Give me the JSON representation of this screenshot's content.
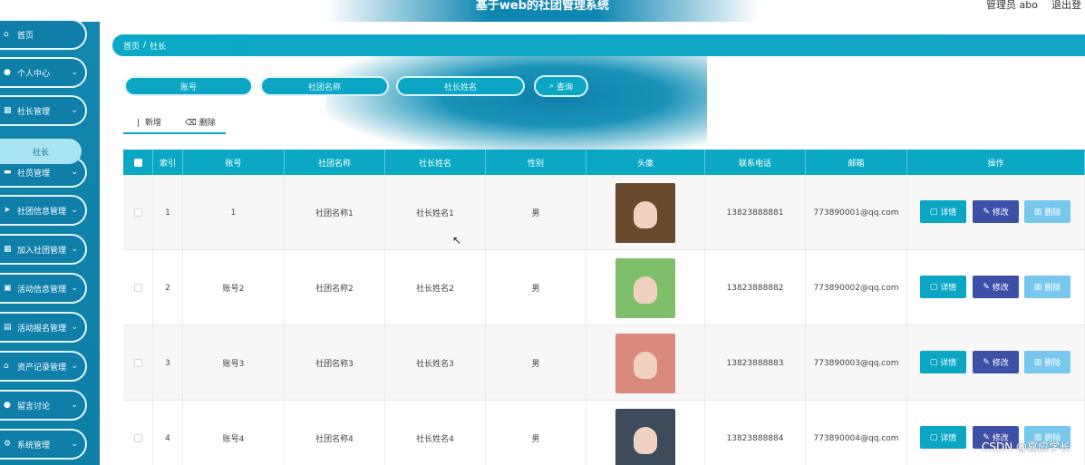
{
  "header": {
    "title": "基于web的社团管理系统",
    "admin_label": "管理员 abo",
    "logout_label": "退出登"
  },
  "sidebar": {
    "items": [
      {
        "label": "首页",
        "icon": "home-icon",
        "glyph": "⌂",
        "has_chevron": false
      },
      {
        "label": "个人中心",
        "icon": "user-icon",
        "glyph": "●",
        "has_chevron": true
      },
      {
        "label": "社长管理",
        "icon": "building-icon",
        "glyph": "▦",
        "has_chevron": true
      },
      {
        "label": "社员管理",
        "icon": "card-icon",
        "glyph": "▬",
        "has_chevron": true
      },
      {
        "label": "社团信息管理",
        "icon": "send-icon",
        "glyph": "➤",
        "has_chevron": true
      },
      {
        "label": "加入社团管理",
        "icon": "building-icon",
        "glyph": "▦",
        "has_chevron": true
      },
      {
        "label": "活动信息管理",
        "icon": "calendar-icon",
        "glyph": "▣",
        "has_chevron": true
      },
      {
        "label": "活动报名管理",
        "icon": "list-icon",
        "glyph": "▤",
        "has_chevron": true
      },
      {
        "label": "资产记录管理",
        "icon": "home-icon",
        "glyph": "⌂",
        "has_chevron": true
      },
      {
        "label": "留言讨论",
        "icon": "pin-icon",
        "glyph": "●",
        "has_chevron": true
      },
      {
        "label": "系统管理",
        "icon": "gear-icon",
        "glyph": "⚙",
        "has_chevron": true
      }
    ],
    "sub_item": "社长"
  },
  "breadcrumb": {
    "home": "首页",
    "separator": "/",
    "current": "社长"
  },
  "search": {
    "account_placeholder": "账号",
    "club_placeholder": "社团名称",
    "leader_placeholder": "社长姓名",
    "query_label": "查询"
  },
  "toolbar": {
    "add_label": "新增",
    "delete_label": "删除"
  },
  "table": {
    "headers": [
      "索引",
      "账号",
      "社团名称",
      "社长姓名",
      "性别",
      "头像",
      "联系电话",
      "邮箱",
      "操作"
    ],
    "rows": [
      {
        "index": "1",
        "account": "1",
        "club": "社团名称1",
        "leader": "社长姓名1",
        "gender": "男",
        "phone": "13823888881",
        "email": "773890001@qq.com",
        "avatar_bg": "#6a4a2c"
      },
      {
        "index": "2",
        "account": "账号2",
        "club": "社团名称2",
        "leader": "社长姓名2",
        "gender": "男",
        "phone": "13823888882",
        "email": "773890002@qq.com",
        "avatar_bg": "#7fbf6a"
      },
      {
        "index": "3",
        "account": "账号3",
        "club": "社团名称3",
        "leader": "社长姓名3",
        "gender": "男",
        "phone": "13823888883",
        "email": "773890003@qq.com",
        "avatar_bg": "#d98a7c"
      },
      {
        "index": "4",
        "account": "账号4",
        "club": "社团名称4",
        "leader": "社长姓名4",
        "gender": "男",
        "phone": "13823888884",
        "email": "773890004@qq.com",
        "avatar_bg": "#3d4a5a"
      }
    ],
    "actions": {
      "detail": "详情",
      "edit": "修改",
      "delete": "删除"
    }
  },
  "watermark": "CSDN @嘉应学长",
  "colors": {
    "accent": "#0ba6c4",
    "sidebar": "#0f7faa",
    "edit": "#3e4fa8",
    "delete": "#78c8ee"
  }
}
